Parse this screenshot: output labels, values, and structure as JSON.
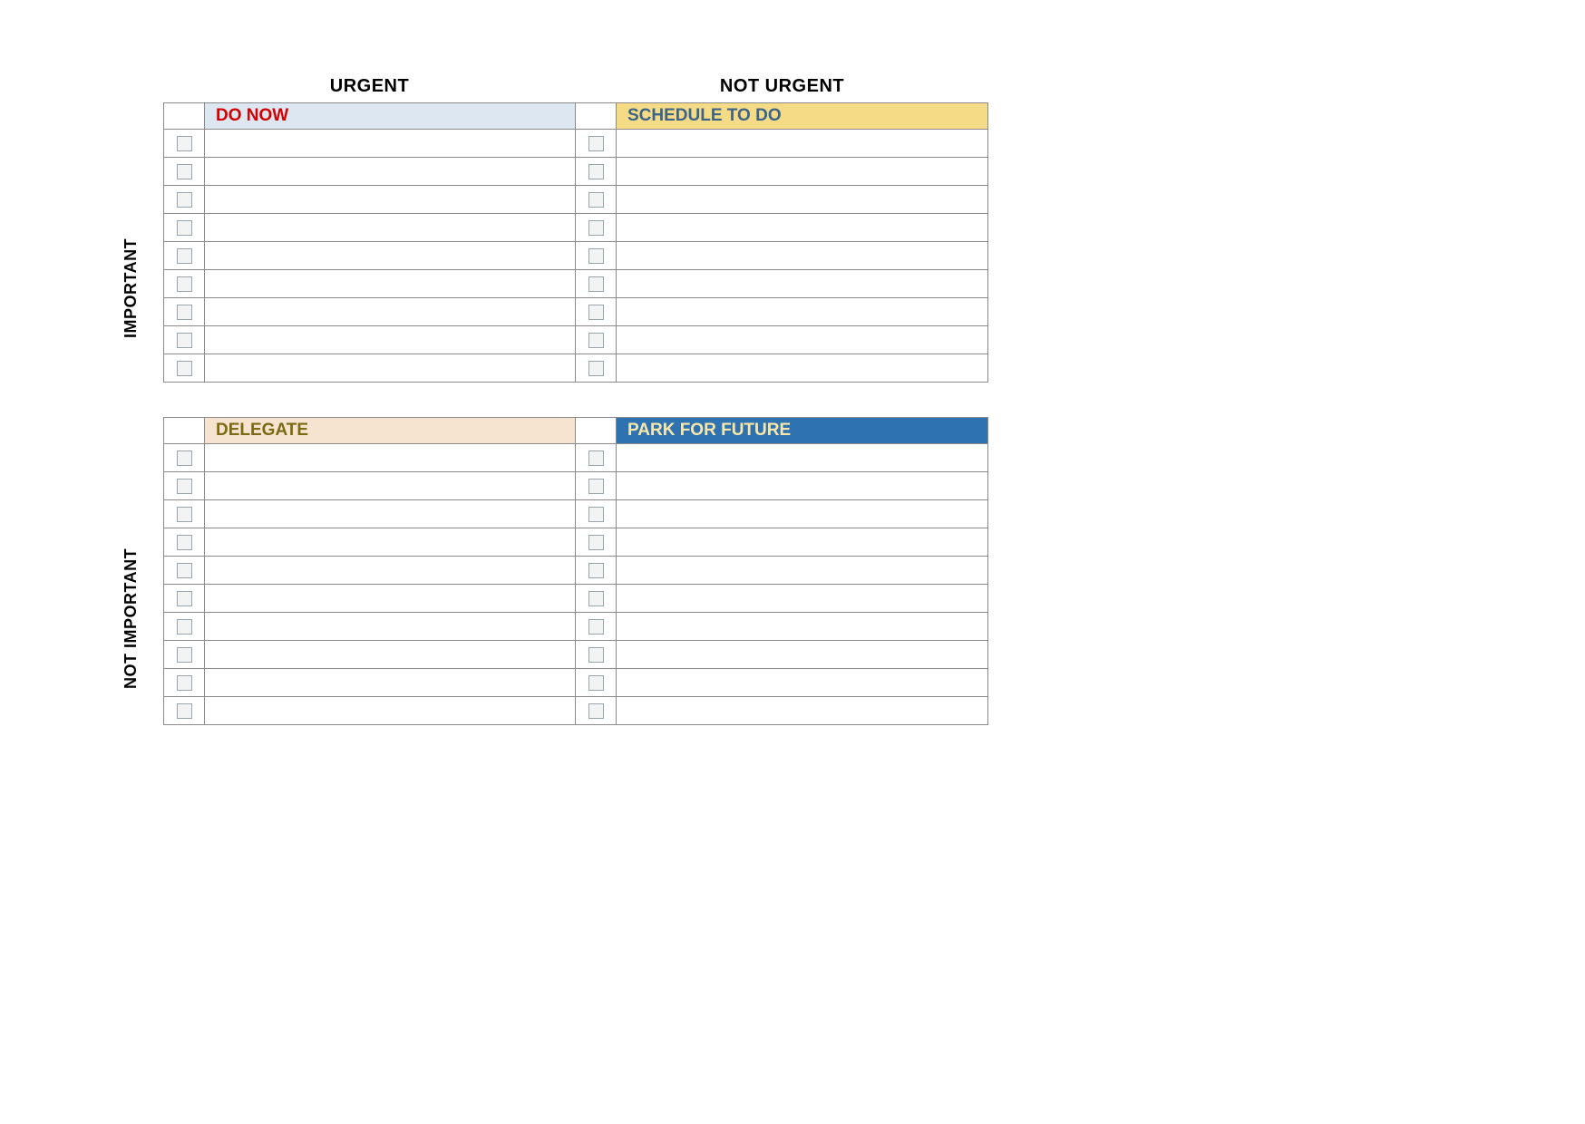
{
  "axes": {
    "top_left": "URGENT",
    "top_right": "NOT URGENT",
    "side_top": "IMPORTANT",
    "side_bottom": "NOT IMPORTANT"
  },
  "quadrants": {
    "do_now": {
      "title": "DO NOW",
      "rows": 9
    },
    "schedule": {
      "title": "SCHEDULE TO DO",
      "rows": 9
    },
    "delegate": {
      "title": "DELEGATE",
      "rows": 10
    },
    "park": {
      "title": "PARK FOR FUTURE",
      "rows": 10
    }
  }
}
